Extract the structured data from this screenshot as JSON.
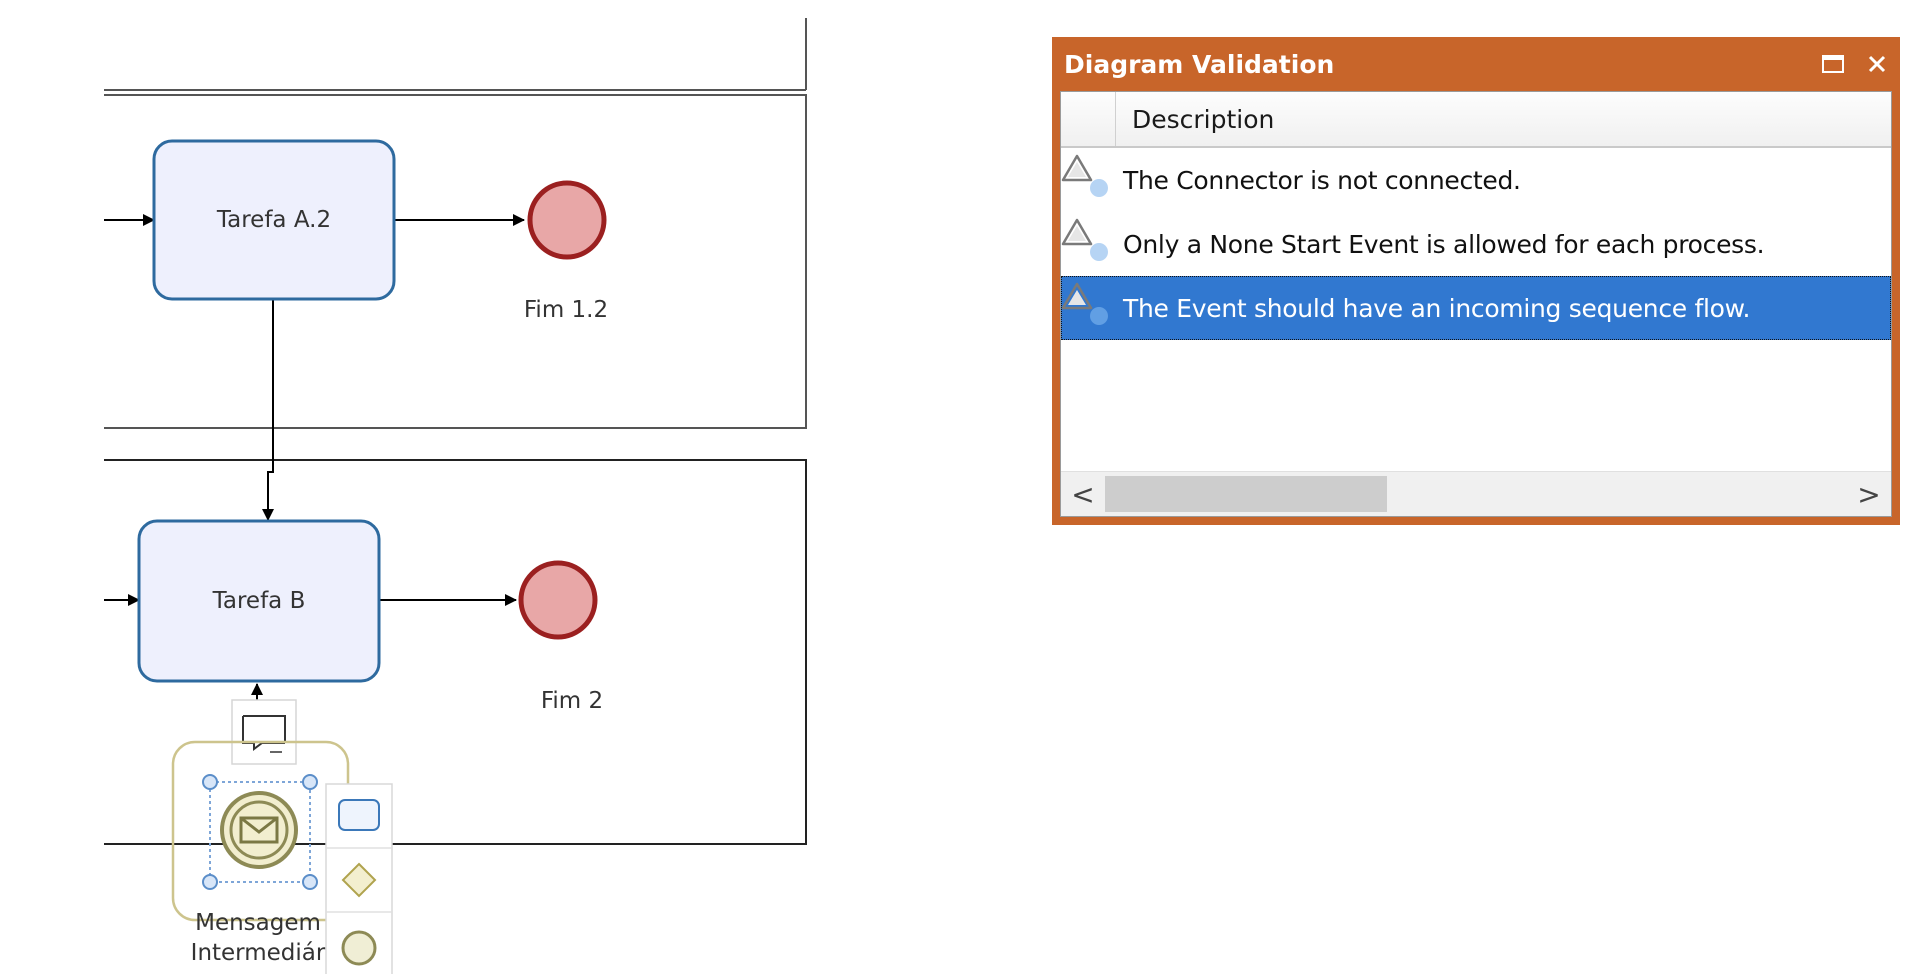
{
  "diagram": {
    "task_a2_label": "Tarefa A.2",
    "task_b_label": "Tarefa B",
    "end_event_1_label": "Fim 1.2",
    "end_event_2_label": "Fim 2",
    "intermediate_event_label_line1": "Mensagem",
    "intermediate_event_label_line2": "Intermediár"
  },
  "validation_panel": {
    "title": "Diagram Validation",
    "column_header": "Description",
    "rows": [
      {
        "text": "The Connector is not connected.",
        "icon": "warning-icon",
        "selected": false
      },
      {
        "text": "Only a None Start Event is allowed for each process.",
        "icon": "warning-icon",
        "selected": false
      },
      {
        "text": "The Event should have an incoming sequence flow.",
        "icon": "warning-icon",
        "selected": true
      }
    ],
    "scroll_left_glyph": "<",
    "scroll_right_glyph": ">",
    "scroll_position": 0.0,
    "scroll_thumb_fraction": 0.38
  },
  "colors": {
    "panel_border": "#c8652a",
    "selection": "#3178d0",
    "task_fill": "#eef0fd",
    "task_stroke": "#2e6a9f",
    "end_event_fill": "#e8a7a7",
    "end_event_stroke": "#9b2020",
    "message_event_stroke": "#8d8a55"
  }
}
